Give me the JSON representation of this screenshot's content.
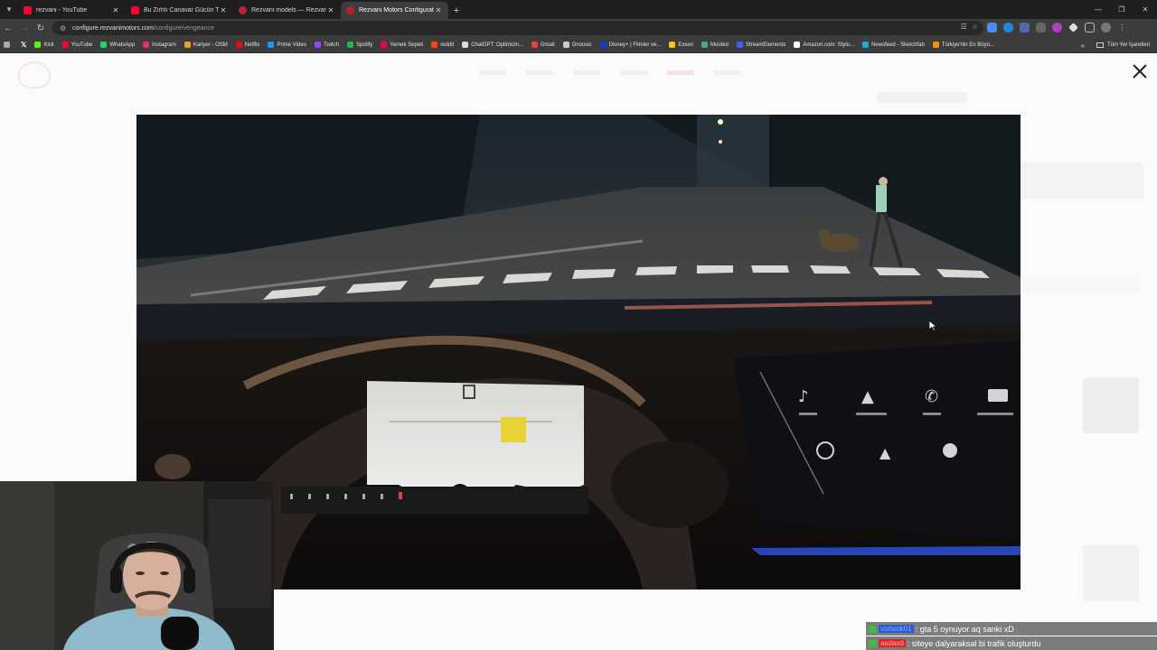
{
  "browser": {
    "tabs": [
      {
        "title": "rezvani - YouTube",
        "favicon": "youtube-icon",
        "active": false
      },
      {
        "title": "Bu Zırhlı Canavar Gücün Tanımı",
        "favicon": "youtube-icon",
        "active": false
      },
      {
        "title": "Rezvani models — Rezvani",
        "favicon": "rezvani-icon",
        "active": false
      },
      {
        "title": "Rezvani Motors Configurator",
        "favicon": "rezvani-icon",
        "active": true
      }
    ],
    "url_host": "configure.rezvanimotors.com",
    "url_path": "/configure/vengeance",
    "bookmarks": [
      {
        "label": "Kick",
        "color": "#53fc18"
      },
      {
        "label": "YouTube",
        "color": "#ff0033"
      },
      {
        "label": "WhatsApp",
        "color": "#25d366"
      },
      {
        "label": "Instagram",
        "color": "#e1306c"
      },
      {
        "label": "Kariyer - OSM",
        "color": "#f0a020"
      },
      {
        "label": "Netflix",
        "color": "#e50914"
      },
      {
        "label": "Prime Video",
        "color": "#1a98ff"
      },
      {
        "label": "Twitch",
        "color": "#9146ff"
      },
      {
        "label": "Spotify",
        "color": "#1db954"
      },
      {
        "label": "Yemek Sepeti",
        "color": "#ea004b"
      },
      {
        "label": "reddit",
        "color": "#ff4500"
      },
      {
        "label": "ChatGPT: Optimizin...",
        "color": "#dddddd"
      },
      {
        "label": "Gmail",
        "color": "#ea4335"
      },
      {
        "label": "Gnoosic",
        "color": "#cccccc"
      },
      {
        "label": "Disney+ | Filmler ve...",
        "color": "#113ccf"
      },
      {
        "label": "Exxen",
        "color": "#f5c518"
      },
      {
        "label": "Moobot",
        "color": "#44aa88"
      },
      {
        "label": "StreamElements",
        "color": "#3066ff"
      },
      {
        "label": "Amazon.com: Stylo...",
        "color": "#ffffff"
      },
      {
        "label": "Newsfeed - Sketchfab",
        "color": "#1caad9"
      },
      {
        "label": "Türkiye'nin En Büyü...",
        "color": "#f29100"
      }
    ],
    "all_bookmarks_label": "Tüm Yer İşaretleri"
  },
  "lightbox": {
    "close_icon": "close-icon"
  },
  "chat": [
    {
      "user": "vorlank01",
      "message": ": gta 5 oynuyor aq sanki xD",
      "user_color": "#2a5bd7"
    },
    {
      "user": "asdasd",
      "message": ": siteye dalyaraksal bi trafik oluşturdu",
      "user_color": "#dd2222"
    }
  ]
}
